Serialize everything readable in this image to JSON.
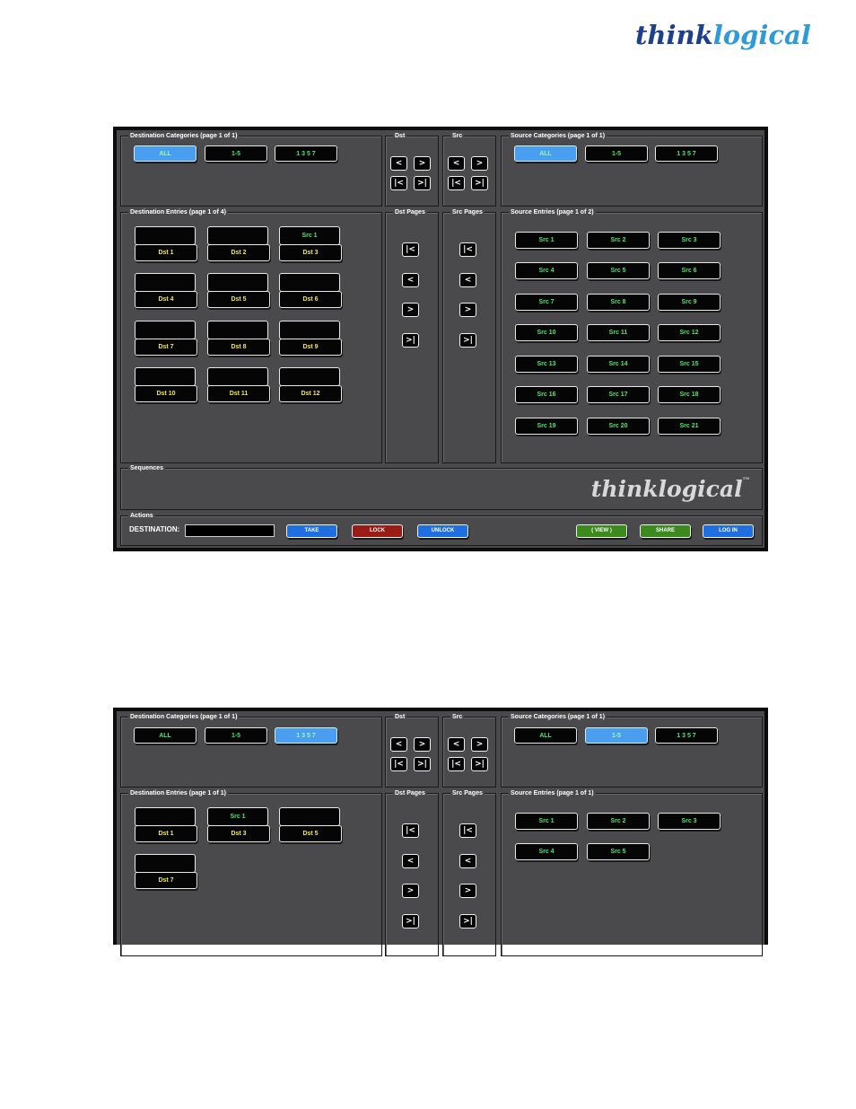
{
  "logo": {
    "part_a": "think",
    "part_b": "logical",
    "color_a": "#1d3f8c",
    "color_b": "#2f9bd6"
  },
  "screen1": {
    "dest_categories_title": "Destination Categories (page 1 of 1)",
    "dest_categories": [
      "ALL",
      "1-5",
      "1 3 5 7"
    ],
    "dest_categories_selected": "ALL",
    "dst_title": "Dst",
    "src_title": "Src",
    "src_categories_title": "Source Categories (page 1 of 1)",
    "src_categories": [
      "ALL",
      "1-5",
      "1 3 5 7"
    ],
    "src_categories_selected": "ALL",
    "dest_entries_title": "Destination Entries (page 1 of 4)",
    "dest_entries": [
      {
        "src": "",
        "dst": "Dst 1"
      },
      {
        "src": "",
        "dst": "Dst 2"
      },
      {
        "src": "Src 1",
        "dst": "Dst 3"
      },
      {
        "src": "",
        "dst": "Dst 4"
      },
      {
        "src": "",
        "dst": "Dst 5"
      },
      {
        "src": "",
        "dst": "Dst 6"
      },
      {
        "src": "",
        "dst": "Dst 7"
      },
      {
        "src": "",
        "dst": "Dst 8"
      },
      {
        "src": "",
        "dst": "Dst 9"
      },
      {
        "src": "",
        "dst": "Dst 10"
      },
      {
        "src": "",
        "dst": "Dst 11"
      },
      {
        "src": "",
        "dst": "Dst 12"
      }
    ],
    "dst_pages_title": "Dst Pages",
    "src_pages_title": "Src Pages",
    "src_entries_title": "Source Entries (page 1 of 2)",
    "src_entries": [
      "Src 1",
      "Src 2",
      "Src 3",
      "Src 4",
      "Src 5",
      "Src 6",
      "Src 7",
      "Src 8",
      "Src 9",
      "Src 10",
      "Src 11",
      "Src 12",
      "Src 13",
      "Src 14",
      "Src 15",
      "Src 16",
      "Src 17",
      "Src 18",
      "Src 19",
      "Src 20",
      "Src 21"
    ],
    "sequences_title": "Sequences",
    "watermark": "thinklogical",
    "watermark_tm": "TM",
    "actions_title": "Actions",
    "destination_label": "DESTINATION:",
    "actions": {
      "take": "TAKE",
      "lock": "LOCK",
      "unlock": "UNLOCK",
      "view": "( VIEW )",
      "share": "SHARE",
      "login": "LOG IN"
    }
  },
  "screen2": {
    "dest_categories_title": "Destination Categories (page 1 of 1)",
    "dest_categories": [
      "ALL",
      "1-5",
      "1 3 5 7"
    ],
    "dest_categories_selected": "1 3 5 7",
    "dst_title": "Dst",
    "src_title": "Src",
    "src_categories_title": "Source Categories (page 1 of 1)",
    "src_categories": [
      "ALL",
      "1-5",
      "1 3 5 7"
    ],
    "src_categories_selected": "1-5",
    "dest_entries_title": "Destination Entries (page 1 of 1)",
    "dest_entries": [
      {
        "src": "",
        "dst": "Dst 1"
      },
      {
        "src": "Src 1",
        "dst": "Dst 3"
      },
      {
        "src": "",
        "dst": "Dst 5"
      },
      {
        "src": "",
        "dst": "Dst 7"
      }
    ],
    "dst_pages_title": "Dst Pages",
    "src_pages_title": "Src Pages",
    "src_entries_title": "Source Entries (page 1 of 1)",
    "src_entries": [
      "Src 1",
      "Src 2",
      "Src 3",
      "Src 4",
      "Src 5"
    ]
  },
  "nav_symbols": {
    "prev": "<",
    "next": ">",
    "first": "|<",
    "last": ">|"
  },
  "colors": {
    "panel_bg": "#4a4a4c",
    "selected_blue": "#4a9ef0",
    "src_text_green": "#55e36f",
    "dst_text_yellow": "#f2e94a",
    "take_blue": "#1f6fe0",
    "lock_red": "#9b1c16",
    "view_share_green": "#3c8a1e"
  }
}
